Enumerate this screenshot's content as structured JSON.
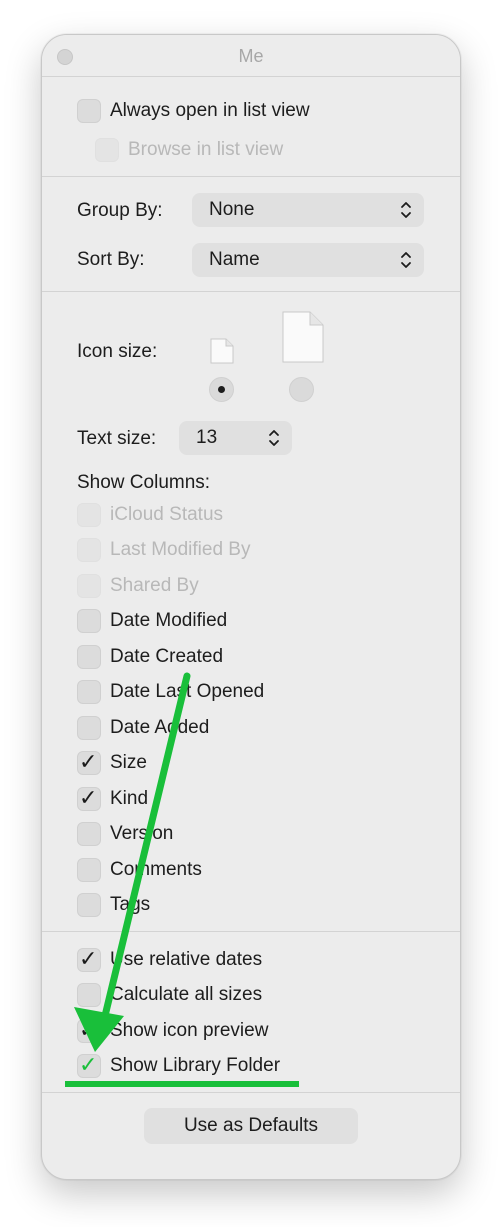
{
  "window": {
    "title": "Me"
  },
  "options": {
    "always_list": {
      "label": "Always open in list view",
      "checked": false
    },
    "browse_list": {
      "label": "Browse in list view",
      "checked": false,
      "enabled": false
    }
  },
  "grouping": {
    "group_by": {
      "label": "Group By:",
      "value": "None"
    },
    "sort_by": {
      "label": "Sort By:",
      "value": "Name"
    }
  },
  "icon_size": {
    "label": "Icon size:",
    "options": [
      {
        "name": "small",
        "selected": true
      },
      {
        "name": "large",
        "selected": false
      }
    ]
  },
  "text_size": {
    "label": "Text size:",
    "value": "13"
  },
  "columns": {
    "heading": "Show Columns:",
    "items": [
      {
        "label": "iCloud Status",
        "checked": false,
        "enabled": false
      },
      {
        "label": "Last Modified By",
        "checked": false,
        "enabled": false
      },
      {
        "label": "Shared By",
        "checked": false,
        "enabled": false
      },
      {
        "label": "Date Modified",
        "checked": false,
        "enabled": true
      },
      {
        "label": "Date Created",
        "checked": false,
        "enabled": true
      },
      {
        "label": "Date Last Opened",
        "checked": false,
        "enabled": true
      },
      {
        "label": "Date Added",
        "checked": false,
        "enabled": true
      },
      {
        "label": "Size",
        "checked": true,
        "enabled": true
      },
      {
        "label": "Kind",
        "checked": true,
        "enabled": true
      },
      {
        "label": "Version",
        "checked": false,
        "enabled": true
      },
      {
        "label": "Comments",
        "checked": false,
        "enabled": true
      },
      {
        "label": "Tags",
        "checked": false,
        "enabled": true
      }
    ]
  },
  "extras": {
    "items": [
      {
        "label": "Use relative dates",
        "checked": true
      },
      {
        "label": "Calculate all sizes",
        "checked": false
      },
      {
        "label": "Show icon preview",
        "checked": true
      },
      {
        "label": "Show Library Folder",
        "checked": true,
        "highlighted": true
      }
    ]
  },
  "defaults_button": {
    "label": "Use as Defaults"
  },
  "annotation": {
    "color": "#19bf3a",
    "icon": "arrow-icon"
  },
  "colors": {
    "window_bg": "#ececec",
    "control_bg": "#e0e0e0",
    "highlight_green": "#19bf3a"
  }
}
